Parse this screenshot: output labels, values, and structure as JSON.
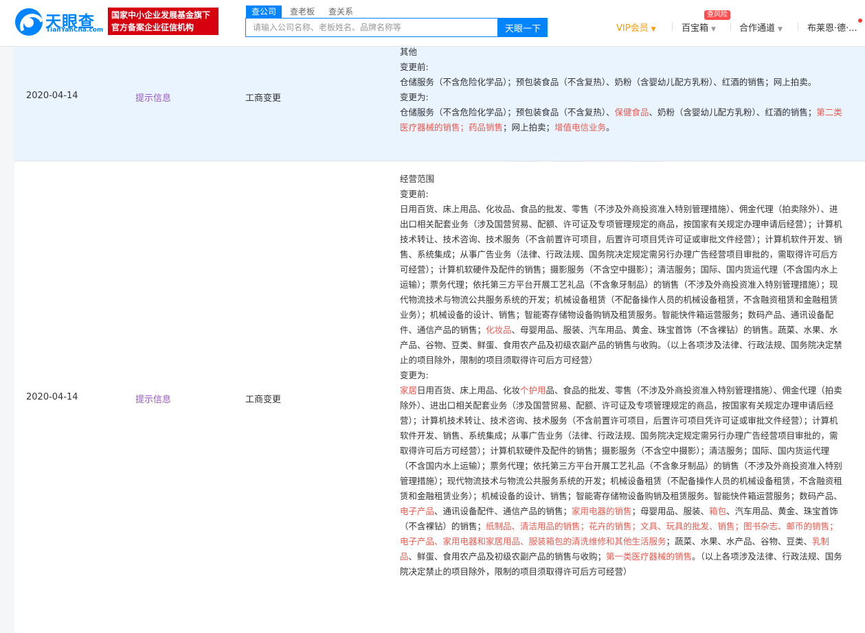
{
  "header": {
    "logo_name": "天眼查",
    "logo_domain": "TianYanCha.com",
    "badge_line1": "国家中小企业发展基金旗下",
    "badge_line2": "官方备案企业征信机构",
    "search_tabs": [
      "查公司",
      "查老板",
      "查关系"
    ],
    "search_placeholder": "请输入公司名称、老板姓名、品牌名称等",
    "search_button": "天眼一下",
    "nav_vip": "VIP会员",
    "nav_baibao": "百宝箱",
    "risk_badge": "查风险",
    "nav_hezuo": "合作通道",
    "nav_user": "布莱恩·德·..."
  },
  "watermark": {
    "text": "天眼查",
    "sub": "TianYanCha.com"
  },
  "rows": [
    {
      "date": "2020-04-14",
      "tip": "提示信息",
      "type": "工商变更",
      "content_title": "其他",
      "before_label": "变更前:",
      "before_text": "仓储服务（不含危险化学品）；预包装食品（不含复热）、奶粉（含婴幼儿配方乳粉）、红酒的销售；网上拍卖。",
      "after_label": "变更为:",
      "after_parts": [
        {
          "t": "仓储服务（不含危险化学品）；预包装食品（不含复热）、",
          "h": false
        },
        {
          "t": "保健食品",
          "h": true
        },
        {
          "t": "、奶粉（含婴幼儿配方乳粉）、红酒的销售；",
          "h": false
        },
        {
          "t": "第二类医疗器械的销售；药品销售",
          "h": true
        },
        {
          "t": "；网上拍卖；",
          "h": false
        },
        {
          "t": "增值电信业务",
          "h": true
        },
        {
          "t": "。",
          "h": false
        }
      ]
    },
    {
      "date": "2020-04-14",
      "tip": "提示信息",
      "type": "工商变更",
      "content_title": "经营范围",
      "before_label": "变更前:",
      "before_parts": [
        {
          "t": "日用百货、床上用品、化妆品、食品的批发、零售（不涉及外商投资准入特别管理措施）、佣金代理（拍卖除外）、进出口相关配套业务（涉及国营贸易、配额、许可证及专项管理规定的商品，按国家有关规定办理申请后经营）；计算机技术转让、技术咨询、技术服务（不含前置许可项目，后置许可项目凭许可证或审批文件经营）；计算机软件开发、销售、系统集成；从事广告业务（法律、行政法规、国务院决定规定需另行办理广告经营项目审批的，需取得许可后方可经营）；计算机软硬件及配件的销售；摄影服务（不含空中摄影）；清洁服务；国际、国内货运代理（不含国内水上运输）；票务代理；依托第三方平台开展工艺礼品（不含象牙制品）的销售（不涉及外商投资准入特别管理措施）；现代物流技术与物流公共服务系统的开发；机械设备租赁（不配备操作人员的机械设备租赁，不含融资租赁和金融租赁业务）；机械设备的设计、销售；智能寄存储物设备购销及租赁服务。智能快件箱运营服务；数码产品、通讯设备配件、通信产品的销售；",
          "h": false
        },
        {
          "t": "化妆品",
          "h": true
        },
        {
          "t": "、母婴用品、服装、汽车用品、黄金、珠宝首饰（不含裸钻）的销售。蔬菜、水果、水产品、谷物、豆类、鲜蛋、食用农产品及初级农副产品的销售与收购。（以上各项涉及法律、行政法规、国务院决定禁止的项目除外，限制的项目须取得许可后方可经营）",
          "h": false
        }
      ],
      "after_label": "变更为:",
      "after_parts": [
        {
          "t": "家居",
          "h": true
        },
        {
          "t": "日用百货、床上用品、化妆",
          "h": false
        },
        {
          "t": "个护用",
          "h": true
        },
        {
          "t": "品、食品的批发、零售（不涉及外商投资准入特别管理措施）、佣金代理（拍卖除外）、进出口相关配套业务（涉及国营贸易、配额、许可证及专项管理规定的商品，按国家有关规定办理申请后经营）；计算机技术转让、技术咨询、技术服务（不含前置许可项目，后置许可项目凭许可证或审批文件经营）；计算机软件开发、销售、系统集成；从事广告业务（法律、行政法规、国务院决定规定需另行办理广告经营项目审批的，需取得许可后方可经营）；计算机软硬件及配件的销售；摄影服务（不含空中摄影）；清洁服务；国际、国内货运代理（不含国内水上运输）；票务代理；依托第三方平台开展工艺礼品（不含象牙制品）的销售（不涉及外商投资准入特别管理措施）；现代物流技术与物流公共服务系统的开发；机械设备租赁（不配备操作人员的机械设备租赁，不含融资租赁和金融租赁业务）；机械设备的设计、销售；智能寄存储物设备购销及租赁服务。智能快件箱运营服务；数码产品、",
          "h": false
        },
        {
          "t": "电子产品",
          "h": true
        },
        {
          "t": "、通讯设备配件、通信产品的销售；",
          "h": false
        },
        {
          "t": "家用电器的销售",
          "h": true
        },
        {
          "t": "；母婴用品、服装、",
          "h": false
        },
        {
          "t": "箱包",
          "h": true
        },
        {
          "t": "、汽车用品、黄金、珠宝首饰（不含裸钻）的销售；",
          "h": false
        },
        {
          "t": "纸制品、清洁用品的销售；花卉的销售；文具、玩具的批发、销售；图书杂志、邮币的销售；电子产品、家用电器和家居用品、服装箱包的清洗维修和其他生活服务",
          "h": true
        },
        {
          "t": "；蔬菜、水果、水产品、谷物、豆类、",
          "h": false
        },
        {
          "t": "乳制品",
          "h": true
        },
        {
          "t": "、鲜蛋、食用农产品及初级农副产品的销售与收购；",
          "h": false
        },
        {
          "t": "第一类医疗器械的销售",
          "h": true
        },
        {
          "t": "。（以上各项涉及法律、行政法规、国务院决定禁止的项目除外，限制的项目须取得许可后方可经营）",
          "h": false
        }
      ]
    }
  ]
}
